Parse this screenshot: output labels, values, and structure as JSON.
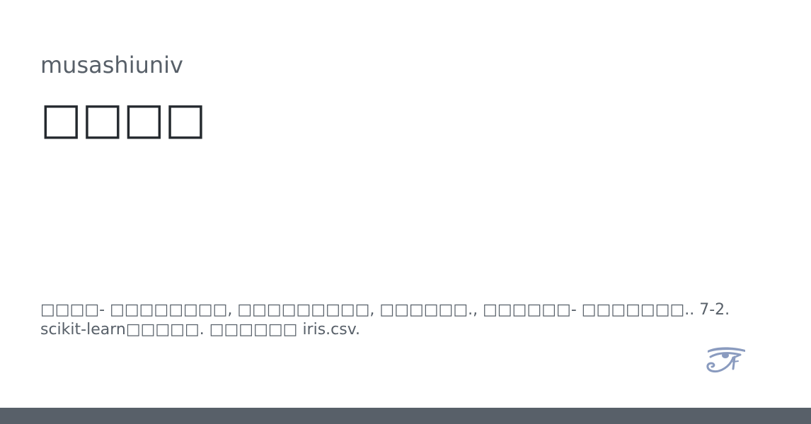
{
  "card": {
    "owner": "musashiuniv",
    "title": "□□□□",
    "description": "□□□□- □□□□□□□□, □□□□□□□□□, □□□□□□., □□□□□□- □□□□□□□.. 7-2. scikit-learn□□□□□. □□□□□□ iris.csv."
  },
  "colors": {
    "owner_text": "#586069",
    "title_text": "#24292e",
    "bottom_bar": "#586069",
    "logo": "#8a9bbf"
  },
  "icons": {
    "logo": "eye-of-horus-icon"
  }
}
